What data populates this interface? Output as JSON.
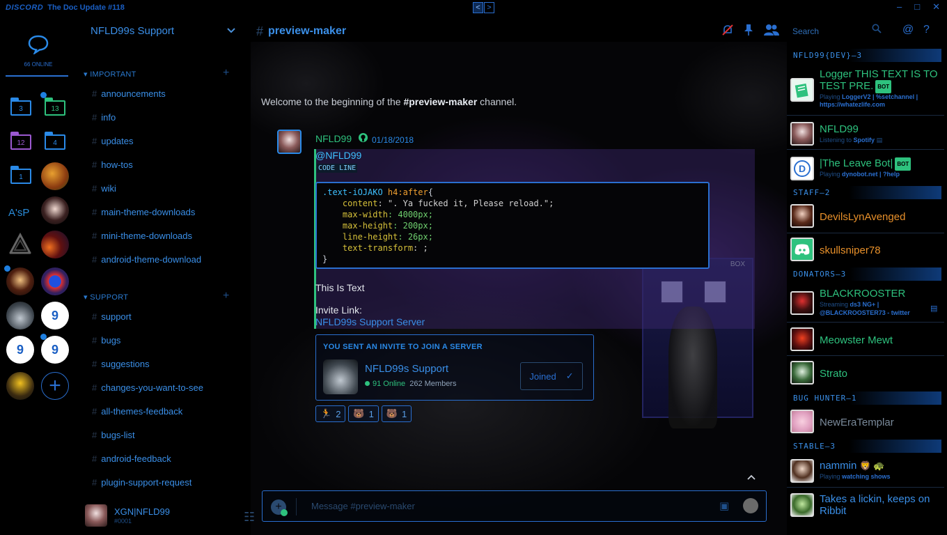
{
  "titlebar": {
    "logo": "DISCORD",
    "title": "The Doc Update #118",
    "back_arrow": "<",
    "forward_arrow": ">",
    "controls": [
      "–",
      "□",
      "✕"
    ]
  },
  "guilds": {
    "online_count": "66 ONLINE",
    "folders": [
      {
        "count": "3",
        "color": "#2a8ae8"
      },
      {
        "count": "13",
        "color": "#2ec27e"
      },
      {
        "count": "12",
        "color": "#9b59d0"
      },
      {
        "count": "4",
        "color": "#2a8ae8"
      },
      {
        "count": "1",
        "color": "#2a8ae8"
      }
    ],
    "asp_label": "A'sP"
  },
  "channels": {
    "server_name": "NFLD99s Support",
    "categories": [
      {
        "name": "IMPORTANT",
        "items": [
          "announcements",
          "info",
          "updates",
          "how-tos",
          "wiki",
          "main-theme-downloads",
          "mini-theme-downloads",
          "android-theme-download"
        ]
      },
      {
        "name": "SUPPORT",
        "items": [
          "support",
          "bugs",
          "suggestions",
          "changes-you-want-to-see",
          "all-themes-feedback",
          "bugs-list",
          "android-feedback",
          "plugin-support-request"
        ]
      }
    ],
    "user": {
      "name": "XGN|NFLD99",
      "tag": "#0001"
    }
  },
  "header": {
    "channel": "preview-maker",
    "search_placeholder": "Search"
  },
  "chat": {
    "welcome_prefix": "Welcome to the beginning of the ",
    "welcome_channel": "#preview-maker",
    "welcome_suffix": " channel.",
    "message": {
      "author": "NFLD99",
      "timestamp": "01/18/2018",
      "mention": "@NFLD99",
      "code_line": "CODE LINE",
      "code": [
        {
          "sel": ".text-iOJAKO ",
          "tag": "h4:after",
          "rest": "{"
        },
        {
          "prop": "    content",
          "val": ": \". Ya fucked it, Please reload.\";"
        },
        {
          "prop": "    max-width",
          "num": ": 4000px;"
        },
        {
          "prop": "    max-height",
          "num": ": 200px;"
        },
        {
          "prop": "    line-height",
          "num": ": 26px;"
        },
        {
          "prop": "    text-transform",
          "val": ": ;"
        },
        {
          "rest": "}"
        }
      ],
      "text": "This Is Text",
      "invite_label": "Invite Link:",
      "invite_link": "NFLD99s Support Server"
    },
    "invite": {
      "heading": "YOU SENT AN INVITE TO JOIN A SERVER",
      "server": "NFLD99s Support",
      "online": "91 Online",
      "members": "262 Members",
      "button": "Joined"
    },
    "reactions": [
      {
        "emoji": "🏃",
        "count": "2"
      },
      {
        "emoji": "🐻",
        "count": "1"
      },
      {
        "emoji": "🐻",
        "count": "1"
      }
    ],
    "composer_placeholder": "Message #preview-maker"
  },
  "members": {
    "groups": [
      {
        "title": "NFLD99{DEV}—3",
        "users": [
          {
            "name": "Logger THIS TEXT IS TO TEST PRE.",
            "color": "#2ec27e",
            "bot": "BOT",
            "activity_prefix": "Playing ",
            "activity": "LoggerV2 | %setchannel | https://whatezlife.com"
          },
          {
            "name": "NFLD99",
            "color": "#2ec27e",
            "activity_prefix": "Listening to ",
            "activity": "Spotify"
          },
          {
            "name": "|The Leave Bot|",
            "color": "#2ec27e",
            "bot": "BOT",
            "activity_prefix": "Playing ",
            "activity": "dynobot.net | ?help"
          }
        ]
      },
      {
        "title": "STAFF—2",
        "users": [
          {
            "name": "DevilsLynAvenged",
            "color": "#e8902a"
          },
          {
            "name": "skullsniper78",
            "color": "#e8902a"
          }
        ]
      },
      {
        "title": "DONATORS—3",
        "users": [
          {
            "name": "BLACKROOSTER",
            "color": "#2ec27e",
            "activity_prefix": "Streaming ",
            "activity": "ds3 NG+ | @BLACKROOSTER73 - twitter"
          },
          {
            "name": "Meowster Mewt",
            "color": "#2ec27e"
          },
          {
            "name": "Strato",
            "color": "#2ec27e"
          }
        ]
      },
      {
        "title": "BUG HUNTER—1",
        "users": [
          {
            "name": "NewEraTemplar",
            "color": "#7a8a9a"
          }
        ]
      },
      {
        "title": "STABLE—3",
        "users": [
          {
            "name": "nammin",
            "color": "#3a8fe8",
            "emojis": "🦁 🐢",
            "activity_prefix": "Playing ",
            "activity": "watching shows"
          },
          {
            "name": "Takes a lickin, keeps on Ribbit",
            "color": "#3a8fe8"
          }
        ]
      }
    ]
  }
}
